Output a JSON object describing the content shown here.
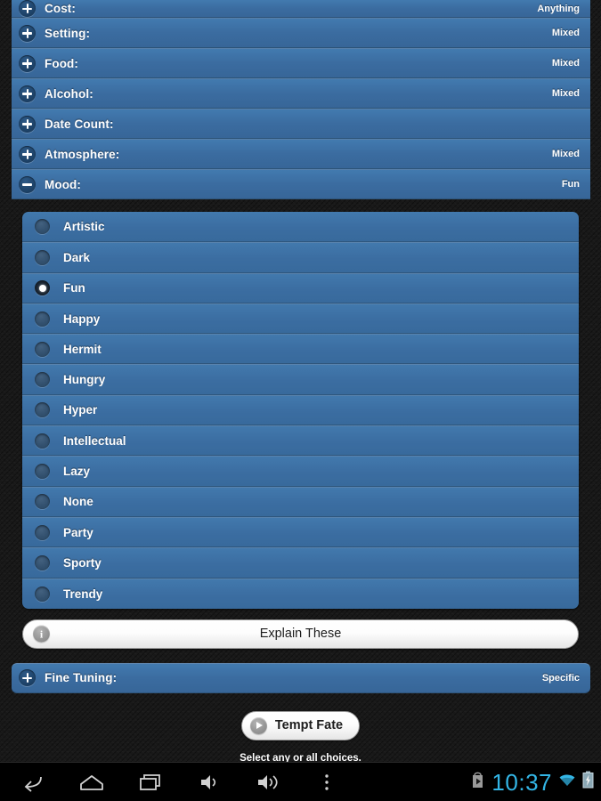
{
  "app": {
    "background_color": "#181818",
    "panel_color": "#3b6da1",
    "accent_color": "#33b5e5"
  },
  "accordion": {
    "rows": [
      {
        "label": "Cost:",
        "value": "Anything",
        "state": "collapsed",
        "icon": "plus-icon",
        "partial": true
      },
      {
        "label": "Setting:",
        "value": "Mixed",
        "state": "collapsed",
        "icon": "plus-icon",
        "partial": false
      },
      {
        "label": "Food:",
        "value": "Mixed",
        "state": "collapsed",
        "icon": "plus-icon",
        "partial": false
      },
      {
        "label": "Alcohol:",
        "value": "Mixed",
        "state": "collapsed",
        "icon": "plus-icon",
        "partial": false
      },
      {
        "label": "Date Count:",
        "value": "",
        "state": "collapsed",
        "icon": "plus-icon",
        "partial": false
      },
      {
        "label": "Atmosphere:",
        "value": "Mixed",
        "state": "collapsed",
        "icon": "plus-icon",
        "partial": false
      },
      {
        "label": "Mood:",
        "value": "Fun",
        "state": "expanded",
        "icon": "minus-icon",
        "partial": false
      }
    ]
  },
  "mood_options": {
    "selected": "Fun",
    "items": [
      {
        "label": "Artistic",
        "checked": false
      },
      {
        "label": "Dark",
        "checked": false
      },
      {
        "label": "Fun",
        "checked": true
      },
      {
        "label": "Happy",
        "checked": false
      },
      {
        "label": "Hermit",
        "checked": false
      },
      {
        "label": "Hungry",
        "checked": false
      },
      {
        "label": "Hyper",
        "checked": false
      },
      {
        "label": "Intellectual",
        "checked": false
      },
      {
        "label": "Lazy",
        "checked": false
      },
      {
        "label": "None",
        "checked": false
      },
      {
        "label": "Party",
        "checked": false
      },
      {
        "label": "Sporty",
        "checked": false
      },
      {
        "label": "Trendy",
        "checked": false
      }
    ]
  },
  "explain_button": {
    "label": "Explain These",
    "icon": "info-icon"
  },
  "fine_tuning": {
    "label": "Fine Tuning:",
    "value": "Specific",
    "icon": "plus-icon"
  },
  "tempt_fate": {
    "label": "Tempt Fate",
    "icon": "play-circle-icon"
  },
  "hint": {
    "text": "Select any or all choices."
  },
  "navbar": {
    "buttons": [
      {
        "name": "back-icon"
      },
      {
        "name": "home-icon"
      },
      {
        "name": "recents-icon"
      },
      {
        "name": "volume-down-icon"
      },
      {
        "name": "volume-up-icon"
      },
      {
        "name": "overflow-menu-icon"
      }
    ],
    "status": {
      "play-store-icon": "play-store",
      "time": "10:37",
      "wifi-icon": "wifi",
      "battery-icon": "battery-charging"
    }
  }
}
